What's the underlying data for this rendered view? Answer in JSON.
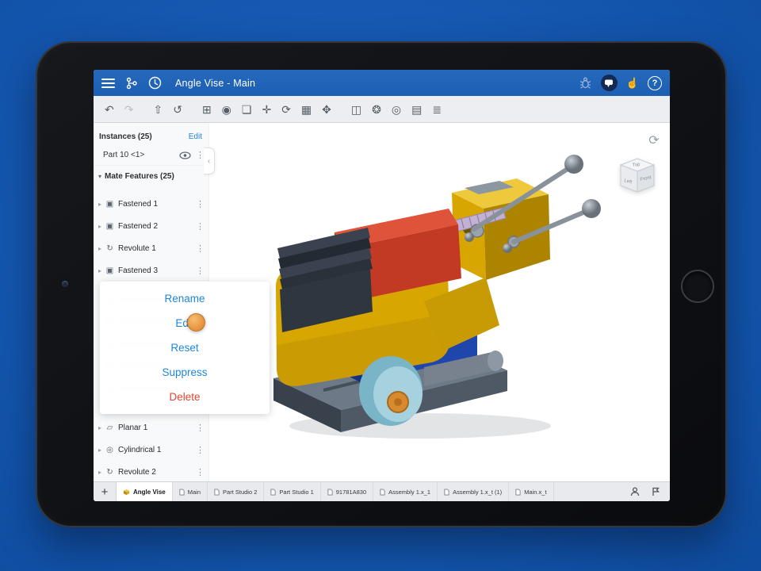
{
  "window": {
    "title": "Angle Vise - Main"
  },
  "topbar": {
    "help_glyph": "?",
    "touch_glyph": "☝"
  },
  "toolbar": {
    "icons": [
      {
        "name": "undo",
        "glyph": "↶"
      },
      {
        "name": "redo",
        "glyph": "↷"
      },
      {
        "name": "export",
        "glyph": "⇧"
      },
      {
        "name": "history",
        "glyph": "↺"
      },
      {
        "name": "insert",
        "glyph": "⊞"
      },
      {
        "name": "mate",
        "glyph": "◉"
      },
      {
        "name": "group",
        "glyph": "❏"
      },
      {
        "name": "move",
        "glyph": "✛"
      },
      {
        "name": "rotate",
        "glyph": "⟳"
      },
      {
        "name": "snap-mode",
        "glyph": "▦"
      },
      {
        "name": "transform",
        "glyph": "✥"
      },
      {
        "name": "section",
        "glyph": "◫"
      },
      {
        "name": "appearance",
        "glyph": "❂"
      },
      {
        "name": "inspect",
        "glyph": "◎"
      },
      {
        "name": "pattern",
        "glyph": "▤"
      },
      {
        "name": "stack",
        "glyph": "≣"
      }
    ]
  },
  "sidebar": {
    "instances_header": "Instances (25)",
    "edit_link": "Edit",
    "part": {
      "label": "Part 10 <1>"
    },
    "mate_header": "Mate Features (25)",
    "chevron_right": "▸",
    "chevron_down": "▾",
    "dots": "⋮",
    "collapse_glyph": "‹",
    "items": [
      {
        "label": "Fastened 1",
        "glyph": "▣"
      },
      {
        "label": "Fastened 2",
        "glyph": "▣"
      },
      {
        "label": "Revolute 1",
        "glyph": "↻"
      },
      {
        "label": "Fastened 3",
        "glyph": "▣"
      }
    ],
    "items_below": [
      {
        "label": "Planar 1",
        "glyph": "▱"
      },
      {
        "label": "Cylindrical 1",
        "glyph": "◎"
      },
      {
        "label": "Revolute 2",
        "glyph": "↻"
      }
    ]
  },
  "context_menu": {
    "items": [
      {
        "label": "Rename"
      },
      {
        "label": "Edit"
      },
      {
        "label": "Reset"
      },
      {
        "label": "Suppress"
      },
      {
        "label": "Delete"
      }
    ]
  },
  "canvas": {
    "rotate_glyph": "⟳"
  },
  "viewcube": {
    "top": "Top",
    "left": "Left",
    "front": "Front"
  },
  "tabbar": {
    "plus": "+",
    "tabs": [
      {
        "label": "Angle Vise"
      },
      {
        "label": "Main"
      },
      {
        "label": "Part Studio 2"
      },
      {
        "label": "Part Studio 1"
      },
      {
        "label": "91781A830"
      },
      {
        "label": "Assembly 1.x_1"
      },
      {
        "label": "Assembly 1.x_t (1)"
      },
      {
        "label": "Main.x_t"
      }
    ]
  },
  "colors": {
    "topbar": "#2063b6",
    "link": "#1e86d9",
    "delete": "#e2472e",
    "touch": "#f2a14a",
    "background": "#1558b0"
  }
}
